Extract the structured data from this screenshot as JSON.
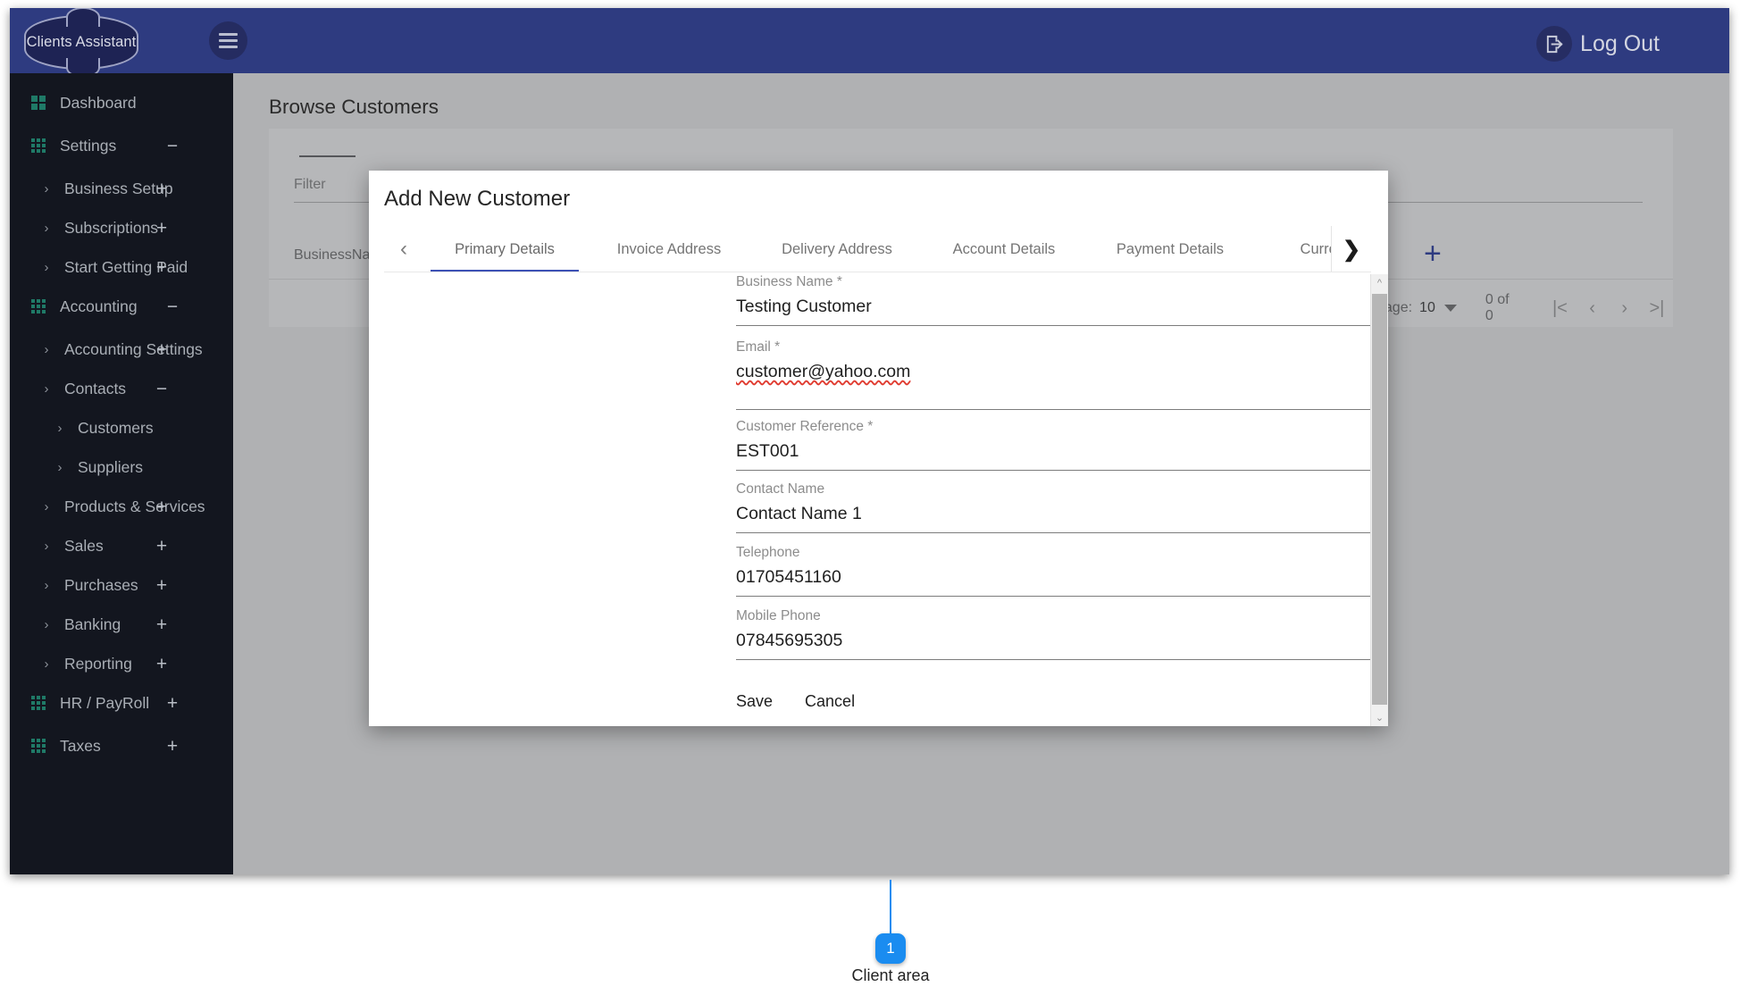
{
  "topbar": {
    "logo_text": "Clients Assistant",
    "menu_icon": "hamburger-icon",
    "logout_label": "Log Out",
    "logout_icon": "logout-arrow-icon",
    "bg_color": "#2e3b80"
  },
  "sidebar": {
    "bg_color": "#13161f",
    "icon_color": "#1f7a67",
    "items": [
      {
        "label": "Dashboard",
        "level": 0,
        "icon": "dashboard-grid-icon",
        "chevron": false,
        "toggle": ""
      },
      {
        "label": "Settings",
        "level": 0,
        "icon": "apps-grid-icon",
        "chevron": false,
        "toggle": "−"
      },
      {
        "label": "Business Setup",
        "level": 1,
        "icon": "",
        "chevron": true,
        "toggle": "+"
      },
      {
        "label": "Subscriptions",
        "level": 1,
        "icon": "",
        "chevron": true,
        "toggle": "+"
      },
      {
        "label": "Start Getting Paid",
        "level": 1,
        "icon": "",
        "chevron": true,
        "toggle": "+"
      },
      {
        "label": "Accounting",
        "level": 0,
        "icon": "apps-grid-icon",
        "chevron": false,
        "toggle": "−"
      },
      {
        "label": "Accounting Settings",
        "level": 1,
        "icon": "",
        "chevron": true,
        "toggle": "+"
      },
      {
        "label": "Contacts",
        "level": 1,
        "icon": "",
        "chevron": true,
        "toggle": "−"
      },
      {
        "label": "Customers",
        "level": 2,
        "icon": "",
        "chevron": true,
        "toggle": ""
      },
      {
        "label": "Suppliers",
        "level": 2,
        "icon": "",
        "chevron": true,
        "toggle": ""
      },
      {
        "label": "Products & Services",
        "level": 1,
        "icon": "",
        "chevron": true,
        "toggle": "+"
      },
      {
        "label": "Sales",
        "level": 1,
        "icon": "",
        "chevron": true,
        "toggle": "+"
      },
      {
        "label": "Purchases",
        "level": 1,
        "icon": "",
        "chevron": true,
        "toggle": "+"
      },
      {
        "label": "Banking",
        "level": 1,
        "icon": "",
        "chevron": true,
        "toggle": "+"
      },
      {
        "label": "Reporting",
        "level": 1,
        "icon": "",
        "chevron": true,
        "toggle": "+"
      },
      {
        "label": "HR / PayRoll",
        "level": 0,
        "icon": "apps-grid-icon",
        "chevron": false,
        "toggle": "+"
      },
      {
        "label": "Taxes",
        "level": 0,
        "icon": "apps-grid-icon",
        "chevron": false,
        "toggle": "+"
      }
    ]
  },
  "page": {
    "title": "Browse Customers",
    "filter_label": "Filter",
    "column_header": "BusinessName",
    "add_button_icon": "plus-icon",
    "paginator": {
      "per_page_label": "page:",
      "per_page_value": "10",
      "range_label": "0 of 0",
      "first_icon": "|<",
      "prev_icon": "‹",
      "next_icon": "›",
      "last_icon": ">|"
    }
  },
  "modal": {
    "title": "Add New Customer",
    "tab_prev_icon": "chevron-left-icon",
    "tab_next_icon": "chevron-right-icon",
    "active_tab_color": "#3d51b5",
    "tabs": [
      {
        "label": "Primary Details",
        "active": true
      },
      {
        "label": "Invoice Address",
        "active": false
      },
      {
        "label": "Delivery Address",
        "active": false
      },
      {
        "label": "Account Details",
        "active": false
      },
      {
        "label": "Payment Details",
        "active": false
      },
      {
        "label": "Currency",
        "active": false
      }
    ],
    "fields": [
      {
        "label": "Business Name *",
        "value": "Testing Customer",
        "spellcheck_underline": false
      },
      {
        "label": "Email *",
        "value": "customer@yahoo.com",
        "spellcheck_underline": true
      },
      {
        "label": "Customer Reference *",
        "value": "EST001",
        "spellcheck_underline": false
      },
      {
        "label": "Contact Name",
        "value": "Contact Name 1",
        "spellcheck_underline": false
      },
      {
        "label": "Telephone",
        "value": "01705451160",
        "spellcheck_underline": false
      },
      {
        "label": "Mobile Phone",
        "value": "07845695305",
        "spellcheck_underline": false
      }
    ],
    "save_label": "Save",
    "cancel_label": "Cancel",
    "scroll_up_icon": "chevron-up-icon",
    "scroll_down_icon": "chevron-down-icon"
  },
  "annotation": {
    "badge_number": "1",
    "label": "Client area",
    "color": "#1a8cf0"
  }
}
